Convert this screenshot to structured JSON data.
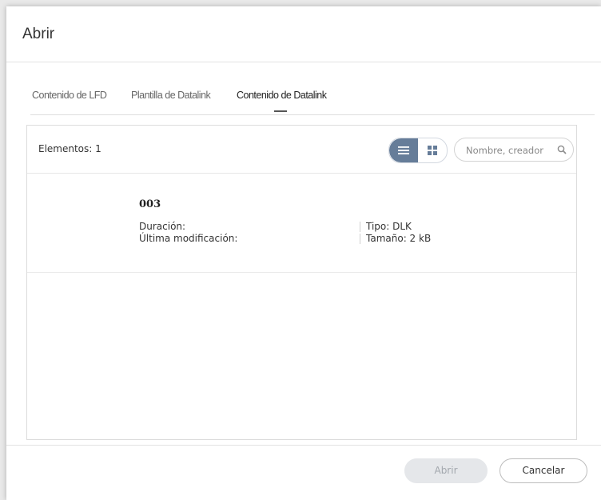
{
  "dialog": {
    "title": "Abrir"
  },
  "tabs": [
    {
      "label": "Contenido de LFD",
      "active": false
    },
    {
      "label": "Plantilla de Datalink",
      "active": false
    },
    {
      "label": "Contenido de Datalink",
      "active": true
    }
  ],
  "panel": {
    "count_label": "Elementos: 1",
    "view_modes": [
      {
        "name": "list-view",
        "icon": "list-icon",
        "active": true
      },
      {
        "name": "grid-view",
        "icon": "grid-icon",
        "active": false
      }
    ],
    "search": {
      "placeholder": "Nombre, creador",
      "value": "",
      "icon": "search-icon"
    },
    "items": [
      {
        "name": "003",
        "duration_label": "Duración:",
        "modified_label": "Última modificación:",
        "type_label": "Tipo: DLK",
        "size_label": "Tamaño: 2 kB"
      }
    ]
  },
  "footer": {
    "open_label": "Abrir",
    "cancel_label": "Cancelar"
  },
  "colors": {
    "accent": "#667d99",
    "disabled_button": "#e5e7ea",
    "disabled_text": "#a3a8ae"
  }
}
